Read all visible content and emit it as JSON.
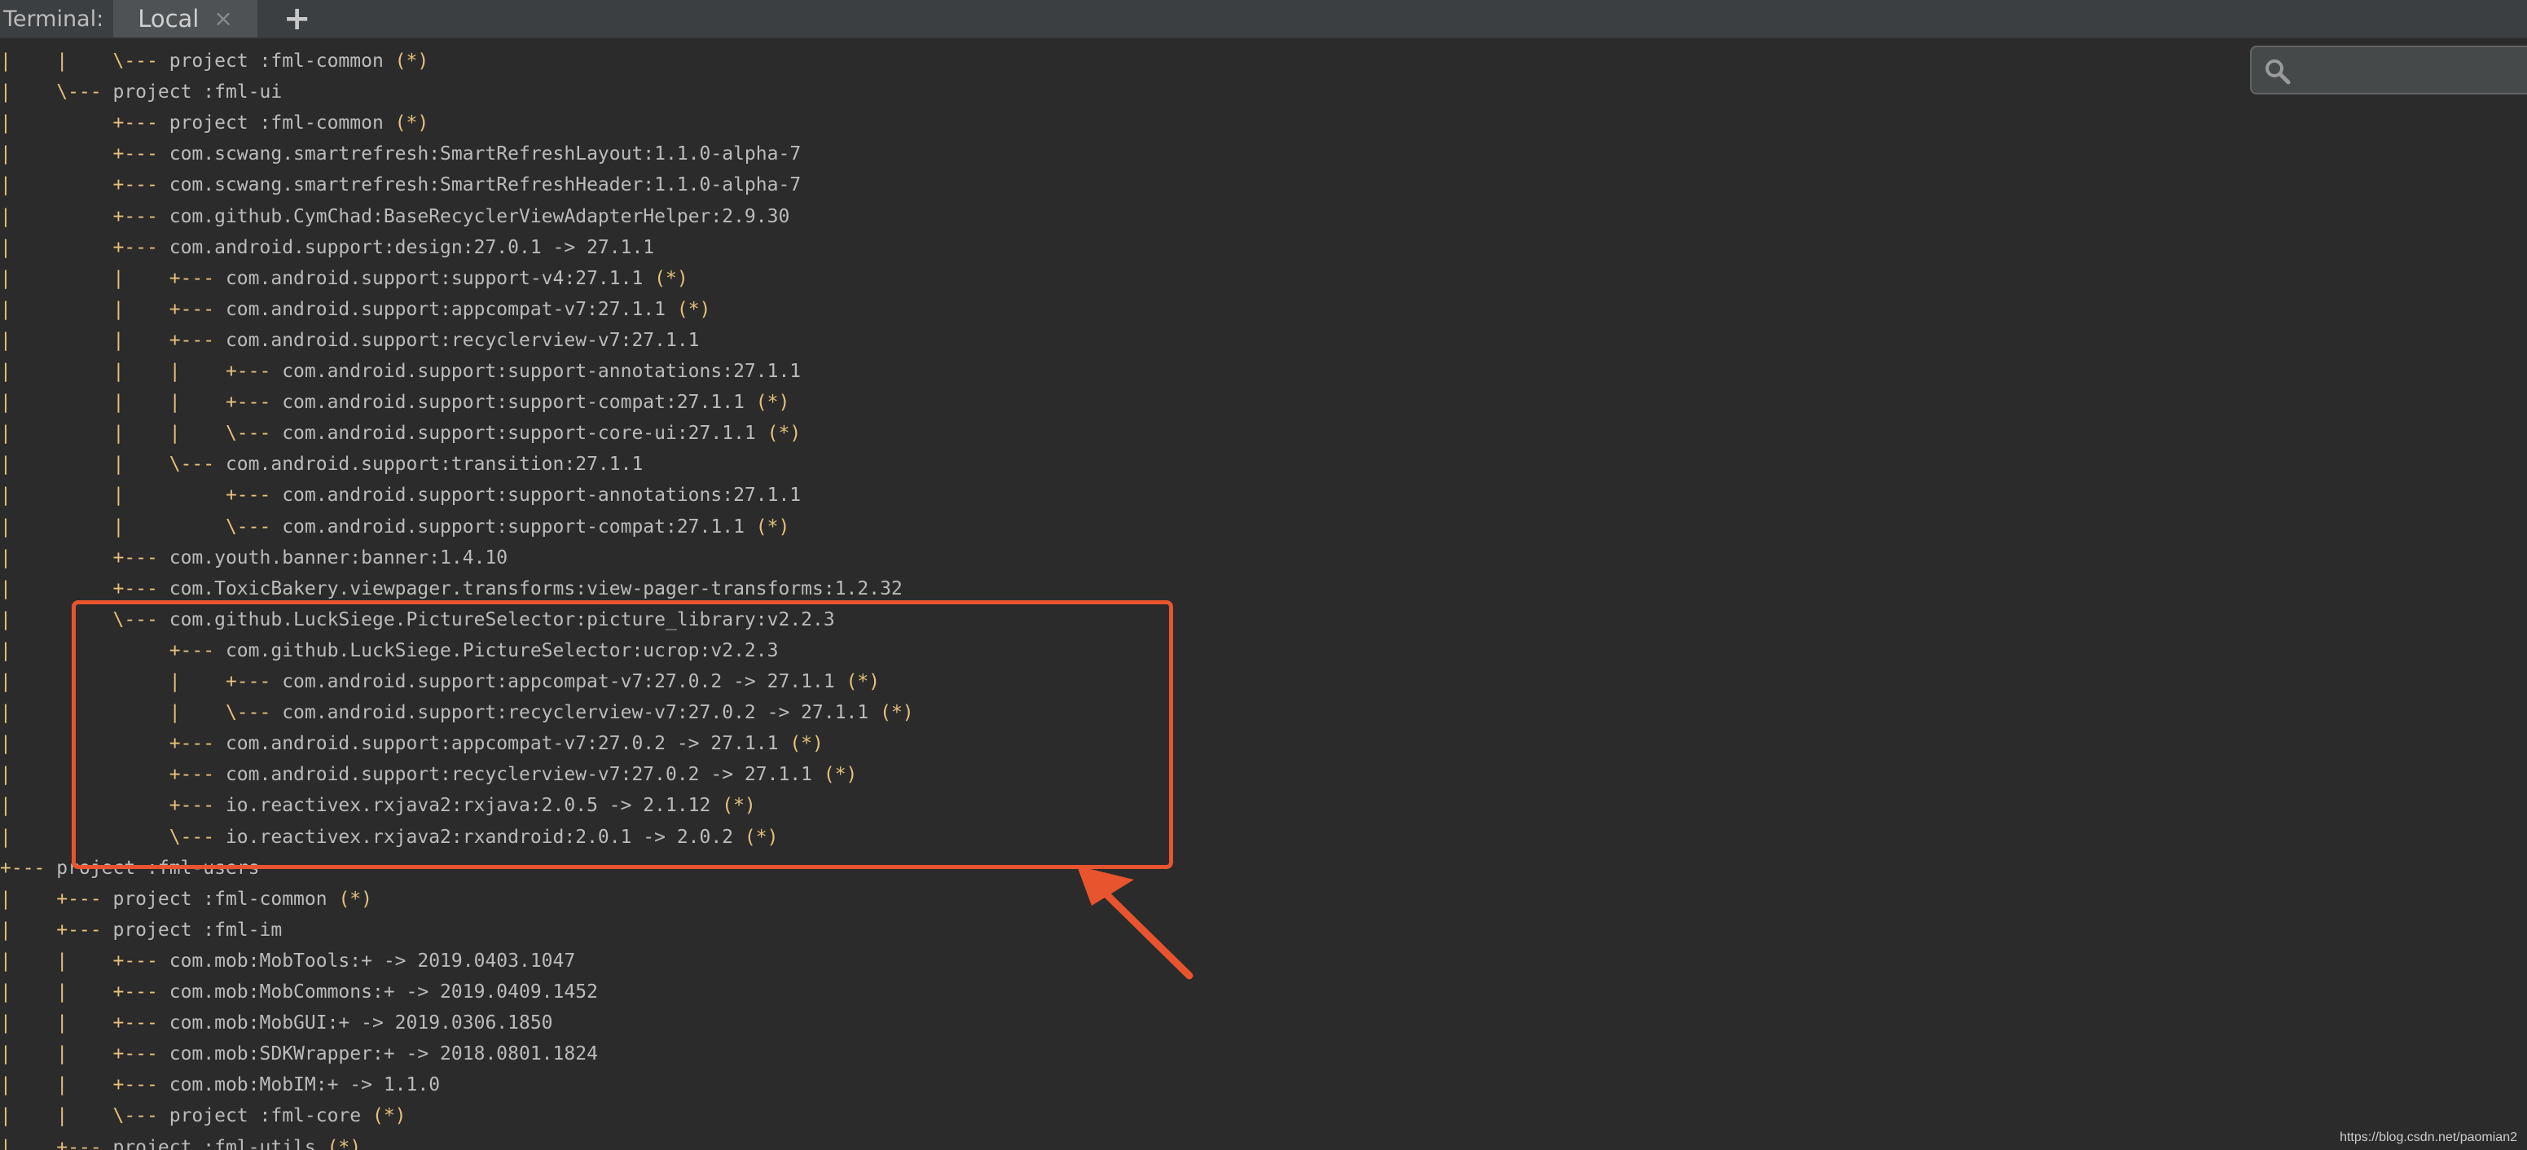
{
  "tabbar": {
    "label": "Terminal:",
    "tab_local": "Local",
    "close_glyph": "×",
    "add_glyph": "+"
  },
  "search": {
    "icon": "search-icon",
    "placeholder": ""
  },
  "terminal": {
    "lines": [
      {
        "tree": "|    |    \\--- ",
        "text": "project :fml-common",
        "mark": " (*)"
      },
      {
        "tree": "|    \\--- ",
        "text": "project :fml-ui",
        "mark": ""
      },
      {
        "tree": "|         +--- ",
        "text": "project :fml-common",
        "mark": " (*)"
      },
      {
        "tree": "|         +--- ",
        "text": "com.scwang.smartrefresh:SmartRefreshLayout:1.1.0-alpha-7",
        "mark": ""
      },
      {
        "tree": "|         +--- ",
        "text": "com.scwang.smartrefresh:SmartRefreshHeader:1.1.0-alpha-7",
        "mark": ""
      },
      {
        "tree": "|         +--- ",
        "text": "com.github.CymChad:BaseRecyclerViewAdapterHelper:2.9.30",
        "mark": ""
      },
      {
        "tree": "|         +--- ",
        "text": "com.android.support:design:27.0.1 -> 27.1.1",
        "mark": ""
      },
      {
        "tree": "|         |    +--- ",
        "text": "com.android.support:support-v4:27.1.1",
        "mark": " (*)"
      },
      {
        "tree": "|         |    +--- ",
        "text": "com.android.support:appcompat-v7:27.1.1",
        "mark": " (*)"
      },
      {
        "tree": "|         |    +--- ",
        "text": "com.android.support:recyclerview-v7:27.1.1",
        "mark": ""
      },
      {
        "tree": "|         |    |    +--- ",
        "text": "com.android.support:support-annotations:27.1.1",
        "mark": ""
      },
      {
        "tree": "|         |    |    +--- ",
        "text": "com.android.support:support-compat:27.1.1",
        "mark": " (*)"
      },
      {
        "tree": "|         |    |    \\--- ",
        "text": "com.android.support:support-core-ui:27.1.1",
        "mark": " (*)"
      },
      {
        "tree": "|         |    \\--- ",
        "text": "com.android.support:transition:27.1.1",
        "mark": ""
      },
      {
        "tree": "|         |         +--- ",
        "text": "com.android.support:support-annotations:27.1.1",
        "mark": ""
      },
      {
        "tree": "|         |         \\--- ",
        "text": "com.android.support:support-compat:27.1.1",
        "mark": " (*)"
      },
      {
        "tree": "|         +--- ",
        "text": "com.youth.banner:banner:1.4.10",
        "mark": ""
      },
      {
        "tree": "|         +--- ",
        "text": "com.ToxicBakery.viewpager.transforms:view-pager-transforms:1.2.32",
        "mark": ""
      },
      {
        "tree": "|         \\--- ",
        "text": "com.github.LuckSiege.PictureSelector:picture_library:v2.2.3",
        "mark": ""
      },
      {
        "tree": "|              +--- ",
        "text": "com.github.LuckSiege.PictureSelector:ucrop:v2.2.3",
        "mark": ""
      },
      {
        "tree": "|              |    +--- ",
        "text": "com.android.support:appcompat-v7:27.0.2 -> 27.1.1",
        "mark": " (*)"
      },
      {
        "tree": "|              |    \\--- ",
        "text": "com.android.support:recyclerview-v7:27.0.2 -> 27.1.1",
        "mark": " (*)"
      },
      {
        "tree": "|              +--- ",
        "text": "com.android.support:appcompat-v7:27.0.2 -> 27.1.1",
        "mark": " (*)"
      },
      {
        "tree": "|              +--- ",
        "text": "com.android.support:recyclerview-v7:27.0.2 -> 27.1.1",
        "mark": " (*)"
      },
      {
        "tree": "|              +--- ",
        "text": "io.reactivex.rxjava2:rxjava:2.0.5 -> 2.1.12",
        "mark": " (*)"
      },
      {
        "tree": "|              \\--- ",
        "text": "io.reactivex.rxjava2:rxandroid:2.0.1 -> 2.0.2",
        "mark": " (*)"
      },
      {
        "tree": "+--- ",
        "text": "project :fml-users",
        "mark": ""
      },
      {
        "tree": "|    +--- ",
        "text": "project :fml-common",
        "mark": " (*)"
      },
      {
        "tree": "|    +--- ",
        "text": "project :fml-im",
        "mark": ""
      },
      {
        "tree": "|    |    +--- ",
        "text": "com.mob:MobTools:+ -> 2019.0403.1047",
        "mark": ""
      },
      {
        "tree": "|    |    +--- ",
        "text": "com.mob:MobCommons:+ -> 2019.0409.1452",
        "mark": ""
      },
      {
        "tree": "|    |    +--- ",
        "text": "com.mob:MobGUI:+ -> 2019.0306.1850",
        "mark": ""
      },
      {
        "tree": "|    |    +--- ",
        "text": "com.mob:SDKWrapper:+ -> 2018.0801.1824",
        "mark": ""
      },
      {
        "tree": "|    |    +--- ",
        "text": "com.mob:MobIM:+ -> 1.1.0",
        "mark": ""
      },
      {
        "tree": "|    |    \\--- ",
        "text": "project :fml-core",
        "mark": " (*)"
      },
      {
        "tree": "|    +--- ",
        "text": "project :fml-utils",
        "mark": " (*)"
      }
    ]
  },
  "annotation": {
    "color": "#e8542d"
  },
  "watermark": "https://blog.csdn.net/paomian2"
}
